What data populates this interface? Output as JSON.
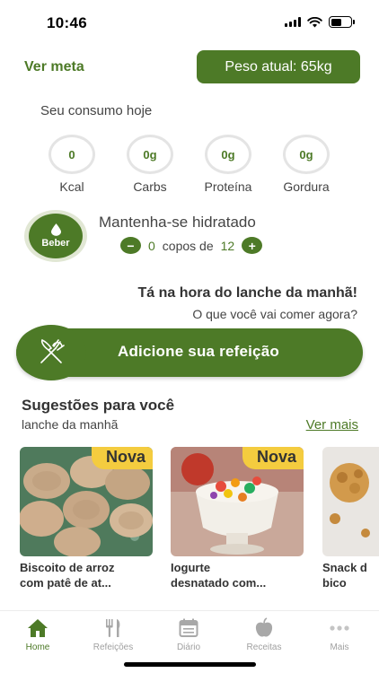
{
  "status": {
    "time": "10:46"
  },
  "header": {
    "ver_meta": "Ver meta",
    "peso_atual": "Peso atual: 65kg"
  },
  "consumo": {
    "title": "Seu consumo hoje",
    "items": [
      {
        "value": "0",
        "label": "Kcal"
      },
      {
        "value": "0g",
        "label": "Carbs"
      },
      {
        "value": "0g",
        "label": "Proteína"
      },
      {
        "value": "0g",
        "label": "Gordura"
      }
    ]
  },
  "hidratacao": {
    "title": "Mantenha-se hidratado",
    "button": "Beber",
    "cups": "0",
    "cups_label": "copos de",
    "goal": "12",
    "minus": "−",
    "plus": "+"
  },
  "lanche": {
    "title": "Tá na hora do lanche da manhã!",
    "subtitle": "O que você vai comer agora?",
    "add_label": "Adicione sua refeição"
  },
  "sugestoes": {
    "title": "Sugestões para você",
    "subtitle": "lanche da manhã",
    "ver_mais": "Ver mais",
    "cards": [
      {
        "badge": "Nova",
        "line1": "Biscoito de arroz",
        "line2": "com patê de at..."
      },
      {
        "badge": "Nova",
        "line1": "Iogurte",
        "line2": "desnatado com..."
      },
      {
        "line1": "Snack d",
        "line2": "bico"
      }
    ]
  },
  "tabbar": {
    "items": [
      {
        "label": "Home",
        "icon": "home-icon"
      },
      {
        "label": "Refeições",
        "icon": "fork-knife-icon"
      },
      {
        "label": "Diário",
        "icon": "calendar-icon"
      },
      {
        "label": "Receitas",
        "icon": "apple-icon"
      },
      {
        "label": "Mais",
        "icon": "more-icon"
      }
    ],
    "active": "Home"
  },
  "colors": {
    "primary": "#4d7a27",
    "badge": "#f4cc3f",
    "ring": "#e4e4e4"
  }
}
